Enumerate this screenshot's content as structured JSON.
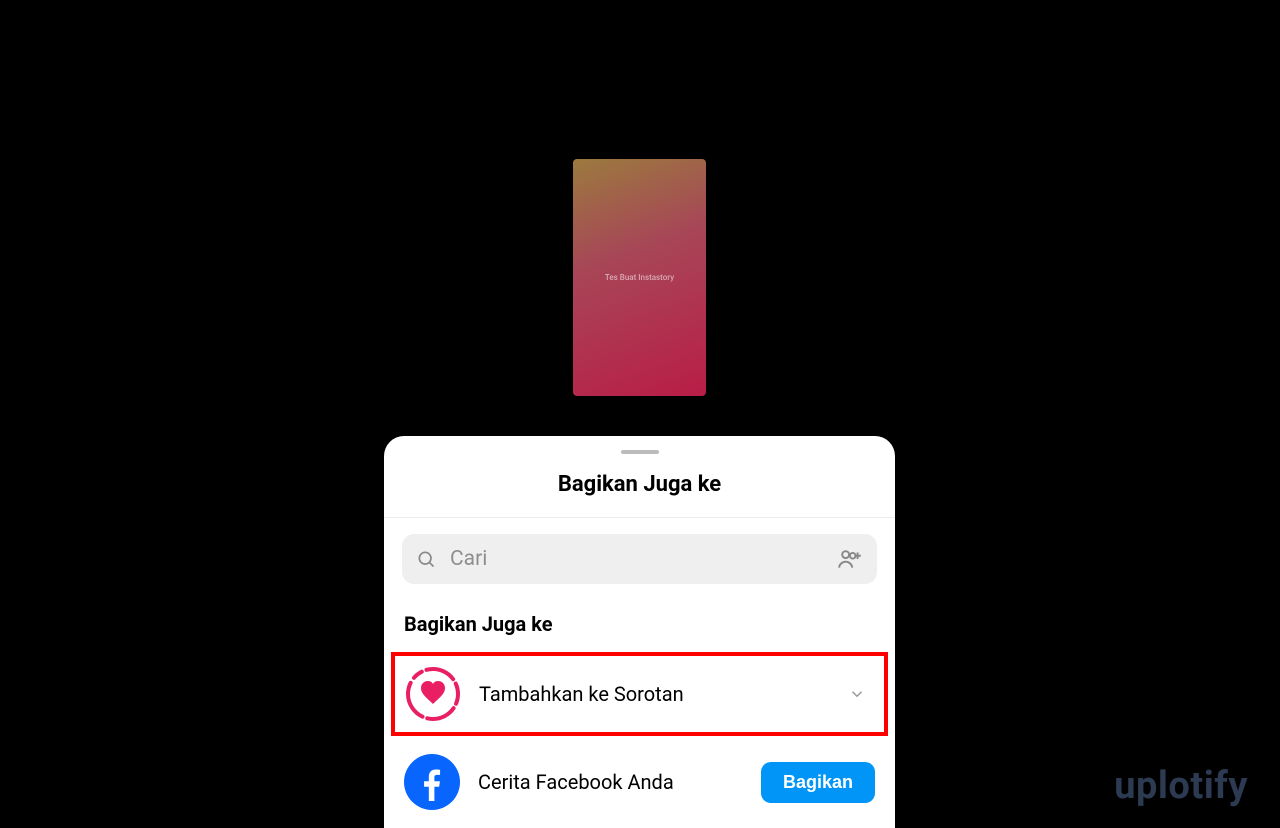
{
  "story": {
    "preview_text": "Tes Buat Instastory"
  },
  "sheet": {
    "title": "Bagikan Juga ke",
    "search_placeholder": "Cari",
    "section_title": "Bagikan Juga ke",
    "highlight": {
      "label": "Tambahkan ke Sorotan",
      "icon_name": "highlight-heart-icon"
    },
    "facebook": {
      "label": "Cerita Facebook Anda",
      "button_label": "Bagikan"
    }
  },
  "watermark": "uplotify"
}
